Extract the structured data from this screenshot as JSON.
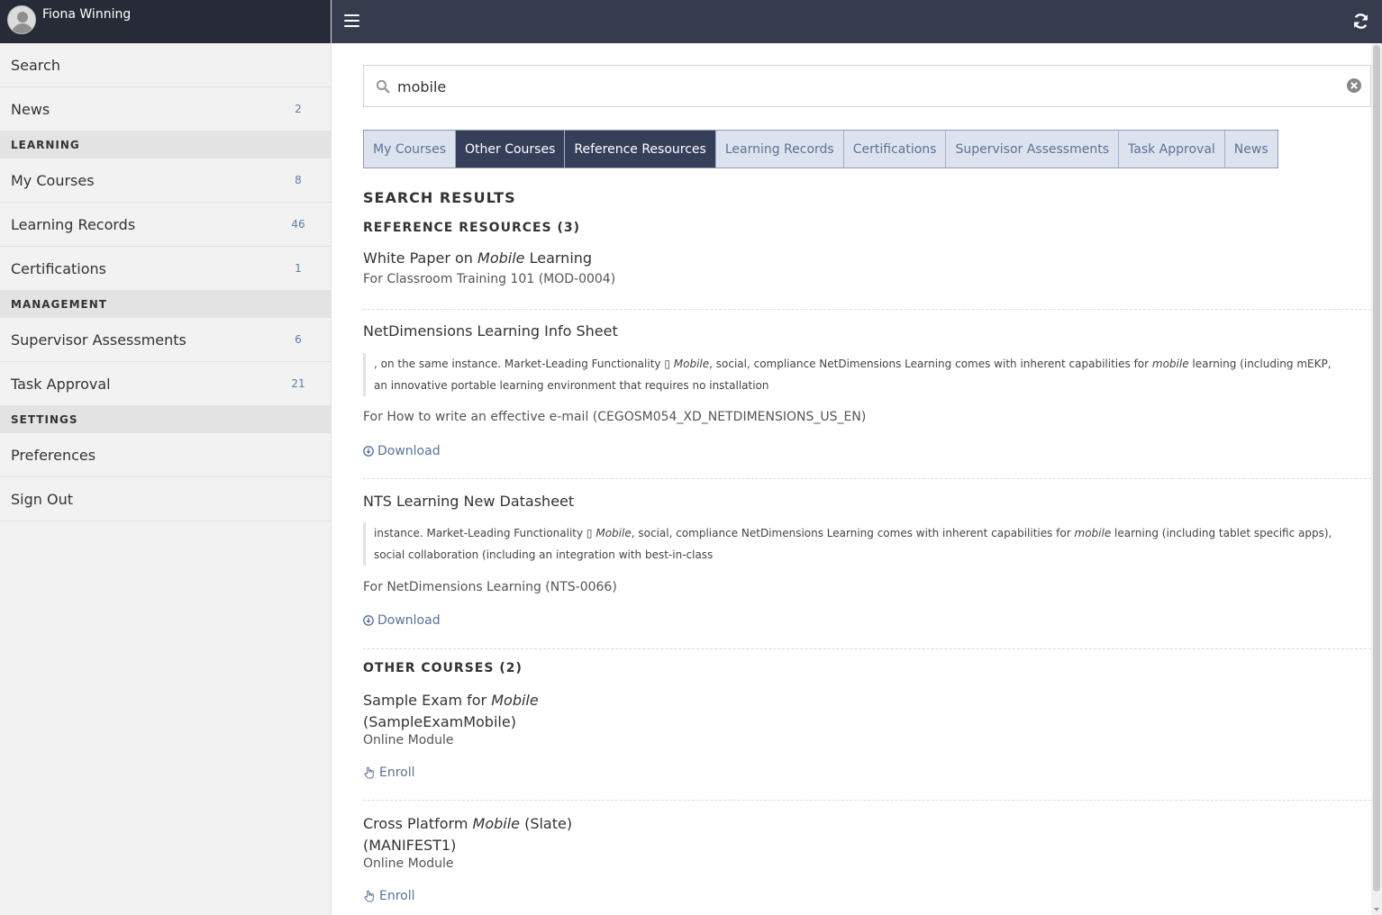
{
  "user": {
    "name": "Fiona Winning",
    "avatar_icon": "user-avatar-icon"
  },
  "sidebar": {
    "items": [
      {
        "label": "Search",
        "count": ""
      },
      {
        "label": "News",
        "count": "2"
      }
    ],
    "sections": [
      {
        "title": "LEARNING",
        "items": [
          {
            "label": "My Courses",
            "count": "8"
          },
          {
            "label": "Learning Records",
            "count": "46"
          },
          {
            "label": "Certifications",
            "count": "1"
          }
        ]
      },
      {
        "title": "MANAGEMENT",
        "items": [
          {
            "label": "Supervisor Assessments",
            "count": "6"
          },
          {
            "label": "Task Approval",
            "count": "21"
          }
        ]
      },
      {
        "title": "SETTINGS",
        "items": [
          {
            "label": "Preferences",
            "count": ""
          },
          {
            "label": "Sign Out",
            "count": ""
          }
        ]
      }
    ]
  },
  "topbar": {
    "menu_icon": "hamburger-menu-icon",
    "refresh_icon": "refresh-icon"
  },
  "search": {
    "value": "mobile",
    "placeholder": ""
  },
  "tabs": [
    {
      "label": "My Courses",
      "active": false
    },
    {
      "label": "Other Courses",
      "active": true
    },
    {
      "label": "Reference Resources",
      "active": true
    },
    {
      "label": "Learning Records",
      "active": false
    },
    {
      "label": "Certifications",
      "active": false
    },
    {
      "label": "Supervisor Assessments",
      "active": false
    },
    {
      "label": "Task Approval",
      "active": false
    },
    {
      "label": "News",
      "active": false
    }
  ],
  "results": {
    "heading": "SEARCH RESULTS",
    "reference": {
      "heading": "REFERENCE RESOURCES (3)",
      "items": [
        {
          "title_pre": "White Paper on ",
          "title_em": "Mobile",
          "title_post": " Learning",
          "sub": "For Classroom Training 101 (MOD-0004)"
        },
        {
          "title": "NetDimensions Learning Info Sheet",
          "excerpt_1": ", on the same instance. Market-Leading Functionality ▯ ",
          "excerpt_em1": "Mobile",
          "excerpt_2": ", social, compliance NetDimensions Learning comes with inherent capabilities for ",
          "excerpt_em2": "mobile",
          "excerpt_3": " learning (including mEKP, an innovative portable learning environment that requires no installation",
          "sub": "For How to write an effective e-mail (CEGOSM054_XD_NETDIMENSIONS_US_EN)",
          "link": "Download"
        },
        {
          "title": "NTS Learning New Datasheet",
          "excerpt_1": "instance. Market-Leading Functionality ▯ ",
          "excerpt_em1": "Mobile",
          "excerpt_2": ", social, compliance NetDimensions Learning comes with inherent capabilities for ",
          "excerpt_em2": "mobile",
          "excerpt_3": " learning (including tablet specific apps), social collaboration (including an integration with best-in-class",
          "sub": "For NetDimensions Learning (NTS-0066)",
          "link": "Download"
        }
      ]
    },
    "other": {
      "heading": "OTHER COURSES (2)",
      "items": [
        {
          "title_pre": "Sample Exam for ",
          "title_em": "Mobile",
          "title_post": "",
          "code": "(SampleExamMobile)",
          "type": "Online Module",
          "link": "Enroll"
        },
        {
          "title_pre": "Cross Platform ",
          "title_em": "Mobile",
          "title_post": " (Slate)",
          "code": "(MANIFEST1)",
          "type": "Online Module",
          "link": "Enroll"
        }
      ]
    }
  }
}
